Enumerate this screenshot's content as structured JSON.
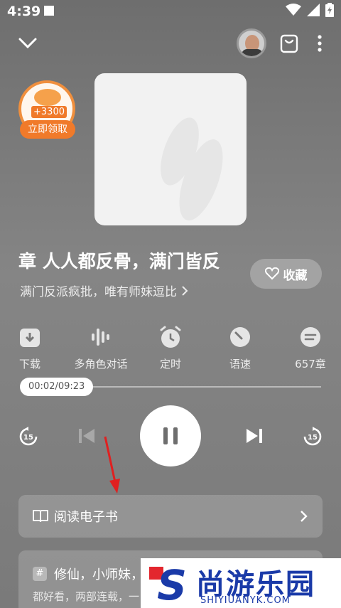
{
  "status_bar": {
    "time": "4:39"
  },
  "header": {
    "back_icon": "chevron-down-icon",
    "share_icon": "bag-icon",
    "more_icon": "more-vertical-icon"
  },
  "reward": {
    "amount": "+3300",
    "button_label": "立即领取"
  },
  "book": {
    "title": "章 人人都反骨，满门皆反",
    "subtitle": "满门反派疯批，唯有师妹逗比",
    "favorite_label": "收藏"
  },
  "actions": [
    {
      "label": "下载",
      "icon": "download-icon"
    },
    {
      "label": "多角色对话",
      "icon": "voice-wave-icon"
    },
    {
      "label": "定时",
      "icon": "timer-icon"
    },
    {
      "label": "语速",
      "icon": "speed-icon"
    },
    {
      "label": "657章",
      "icon": "chapters-icon"
    }
  ],
  "player": {
    "time_display": "00:02/09:23",
    "progress": 0.0036,
    "rewind_label": "15",
    "forward_label": "15"
  },
  "ebook": {
    "label": "阅读电子书"
  },
  "tags": {
    "line": "修仙，小师妹，",
    "sub": "都好看，两部连载，一"
  },
  "watermark": {
    "brand": "尚游乐园",
    "url": "SHIYIUANYK.COM",
    "logo_letter": "S"
  },
  "colors": {
    "accent_orange": "#f07a2a",
    "watermark_blue": "#1a3aa8"
  }
}
